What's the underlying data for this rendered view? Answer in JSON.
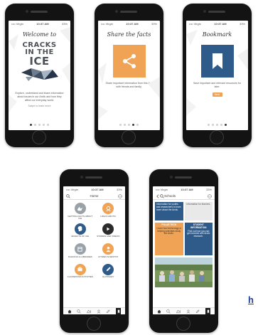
{
  "status_bar": {
    "carrier": "•••• Virgin",
    "time": "10:37 AM",
    "battery": "33%"
  },
  "screens": {
    "welcome": {
      "title": "Welcome to",
      "logo_lines": [
        "CRACKS",
        "IN THE",
        "ICE"
      ],
      "body": "Explore, understand and share information about issues in our Arctic and how they affect our everyday world.",
      "link": "Swipe to learn more"
    },
    "share": {
      "title": "Share the facts",
      "body": "Share important information from this app with friends and family."
    },
    "bookmark": {
      "title": "Bookmark",
      "body": "Save important and relevant resources for later.",
      "next_label": "Next"
    },
    "home": {
      "title": "Home",
      "items": [
        {
          "label": "Getting Facts About Ice",
          "color": "#9aa2a9",
          "icon": "ice-icon"
        },
        {
          "label": "Life in Arctic",
          "color": "#f0a255",
          "icon": "arctic-life-icon"
        },
        {
          "label": "Effects of Ice",
          "color": "#2f5b8a",
          "icon": "head-icon"
        },
        {
          "label": "Stories and Videos",
          "color": "#2b2b2b",
          "icon": "play-icon"
        },
        {
          "label": "Schools & Libraries",
          "color": "#9aa2a9",
          "icon": "library-icon"
        },
        {
          "label": "Citizen Scientist",
          "color": "#f0a255",
          "icon": "person-icon"
        },
        {
          "label": "Classroom Activities",
          "color": "#f0a255",
          "icon": "briefcase-icon"
        },
        {
          "label": "Glossary",
          "color": "#2f5b8a",
          "icon": "pencil-icon"
        }
      ]
    },
    "schools": {
      "title": "Schools",
      "top_cards": [
        {
          "text": "Information for youths and researchers to learn more about the Arctic.",
          "color": "#2f5b8a"
        },
        {
          "text": "Information for learners.",
          "color": "#e9e9e9"
        }
      ],
      "cards": [
        {
          "title": "Polar Tech",
          "text": "Learn how technology is helping scientists study the Arctic.",
          "color": "#f0a255"
        },
        {
          "title": "Student Information",
          "text": "Find out how you can get involved with Arctic research.",
          "color": "#2f5b8a"
        }
      ]
    }
  },
  "page_dots": {
    "count": 5
  },
  "edge_link_text": "h"
}
